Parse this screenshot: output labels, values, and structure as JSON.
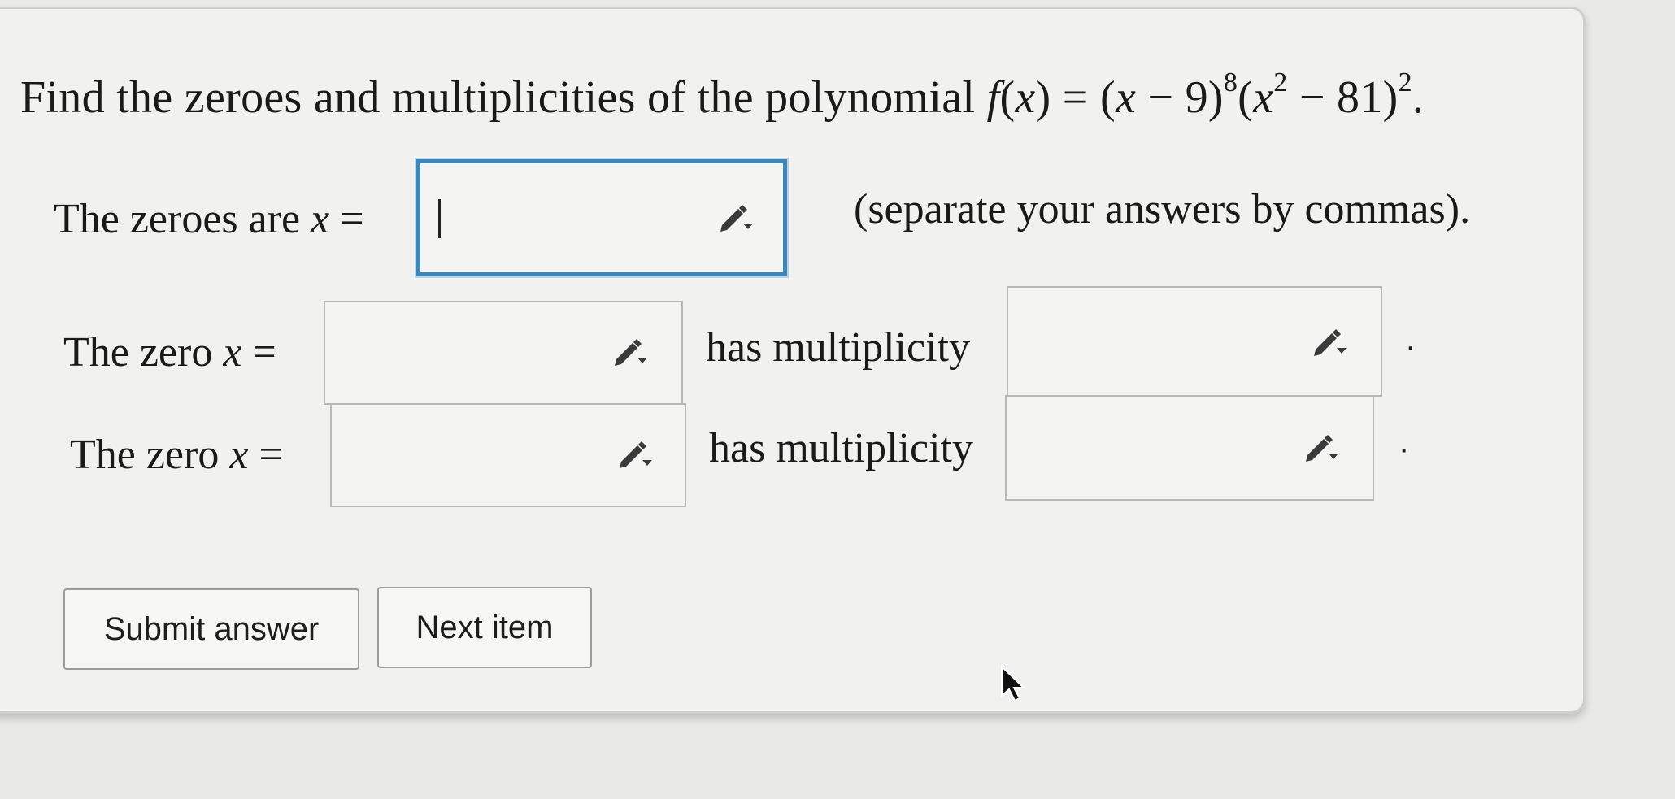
{
  "question": {
    "prefix": "Find the zeroes and multiplicities of the polynomial ",
    "func": "f",
    "paren_open": "(",
    "var_x": "x",
    "paren_close_eq": ") = (",
    "var_x2": "x",
    "minus_9": " − 9)",
    "exp_8": "8",
    "paren_open2": "(",
    "var_x3": "x",
    "exp_2a": "2",
    "minus_81": " − 81)",
    "exp_2b": "2",
    "period": "."
  },
  "zeroes_row": {
    "label_prefix": "The zeroes are ",
    "label_var": "x",
    "label_eq": " =",
    "input_value": "",
    "hint": "(separate your answers by commas)."
  },
  "zero_rows": [
    {
      "label_prefix": "The zero ",
      "label_var": "x",
      "label_eq": " =",
      "zero_value": "",
      "mult_label": "has multiplicity",
      "mult_value": "",
      "end_dot": "·"
    },
    {
      "label_prefix": "The zero ",
      "label_var": "x",
      "label_eq": " =",
      "zero_value": "",
      "mult_label": "has multiplicity",
      "mult_value": "",
      "end_dot": "·"
    }
  ],
  "buttons": {
    "submit": "Submit answer",
    "next": "Next item"
  },
  "icons": {
    "edit": "pencil-dropdown-icon",
    "cursor": "mouse-pointer-icon"
  },
  "colors": {
    "active_border": "#3f86b8",
    "panel_bg": "#f1f1ef"
  }
}
